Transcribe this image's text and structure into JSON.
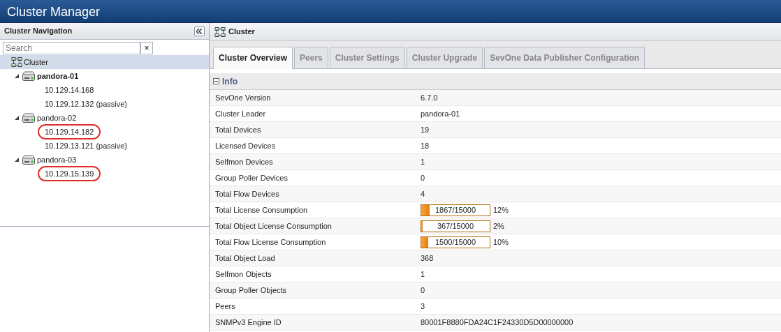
{
  "window": {
    "title": "Cluster Manager"
  },
  "sidebar": {
    "title": "Cluster Navigation",
    "search": {
      "placeholder": "Search",
      "clear": "×"
    },
    "tree": [
      {
        "label": "Cluster",
        "kind": "cluster",
        "selected": true,
        "children": [
          {
            "label": "pandora-01",
            "kind": "server",
            "bold": true,
            "expanded": true,
            "selected": false,
            "children": [
              {
                "label": "10.129.14.168",
                "kind": "ip",
                "circled": false,
                "selected": false
              },
              {
                "label": "10.129.12.132 (passive)",
                "kind": "ip",
                "circled": false,
                "selected": false
              }
            ]
          },
          {
            "label": "pandora-02",
            "kind": "server",
            "bold": false,
            "expanded": true,
            "selected": false,
            "children": [
              {
                "label": "10.129.14.182",
                "kind": "ip",
                "circled": true,
                "selected": false
              },
              {
                "label": "10.129.13.121 (passive)",
                "kind": "ip",
                "circled": false,
                "selected": false
              }
            ]
          },
          {
            "label": "pandora-03",
            "kind": "server",
            "bold": false,
            "expanded": true,
            "selected": false,
            "children": [
              {
                "label": "10.129.15.139",
                "kind": "ip",
                "circled": true,
                "selected": false
              }
            ]
          }
        ]
      }
    ]
  },
  "main": {
    "title": "Cluster",
    "tabs": [
      {
        "label": "Cluster Overview",
        "selected": true
      },
      {
        "label": "Peers",
        "selected": false
      },
      {
        "label": "Cluster Settings",
        "selected": false
      },
      {
        "label": "Cluster Upgrade",
        "selected": false
      },
      {
        "label": "SevOne Data Publisher Configuration",
        "selected": false
      }
    ],
    "section": {
      "title": "Info",
      "expanded": true
    },
    "rows": [
      {
        "label": "SevOne Version",
        "kind": "text",
        "value": "6.7.0"
      },
      {
        "label": "Cluster Leader",
        "kind": "text",
        "value": "pandora-01"
      },
      {
        "label": "Total Devices",
        "kind": "text",
        "value": "19"
      },
      {
        "label": "Licensed Devices",
        "kind": "text",
        "value": "18"
      },
      {
        "label": "Selfmon Devices",
        "kind": "text",
        "value": "1"
      },
      {
        "label": "Group Poller Devices",
        "kind": "text",
        "value": "0"
      },
      {
        "label": "Total Flow Devices",
        "kind": "text",
        "value": "4"
      },
      {
        "label": "Total License Consumption",
        "kind": "meter",
        "value": "1867/15000",
        "level": 0.12,
        "percent": "12%"
      },
      {
        "label": "Total Object License Consumption",
        "kind": "meter",
        "value": "367/15000",
        "level": 0.02,
        "percent": "2%"
      },
      {
        "label": "Total Flow License Consumption",
        "kind": "meter",
        "value": "1500/15000",
        "level": 0.1,
        "percent": "10%"
      },
      {
        "label": "Total Object Load",
        "kind": "text",
        "value": "368"
      },
      {
        "label": "Selfmon Objects",
        "kind": "text",
        "value": "1"
      },
      {
        "label": "Group Poller Objects",
        "kind": "text",
        "value": "0"
      },
      {
        "label": "Peers",
        "kind": "text",
        "value": "3"
      },
      {
        "label": "SNMPv3 Engine ID",
        "kind": "text",
        "value": "80001F8880FDA24C1F24330D5D00000000"
      }
    ]
  }
}
